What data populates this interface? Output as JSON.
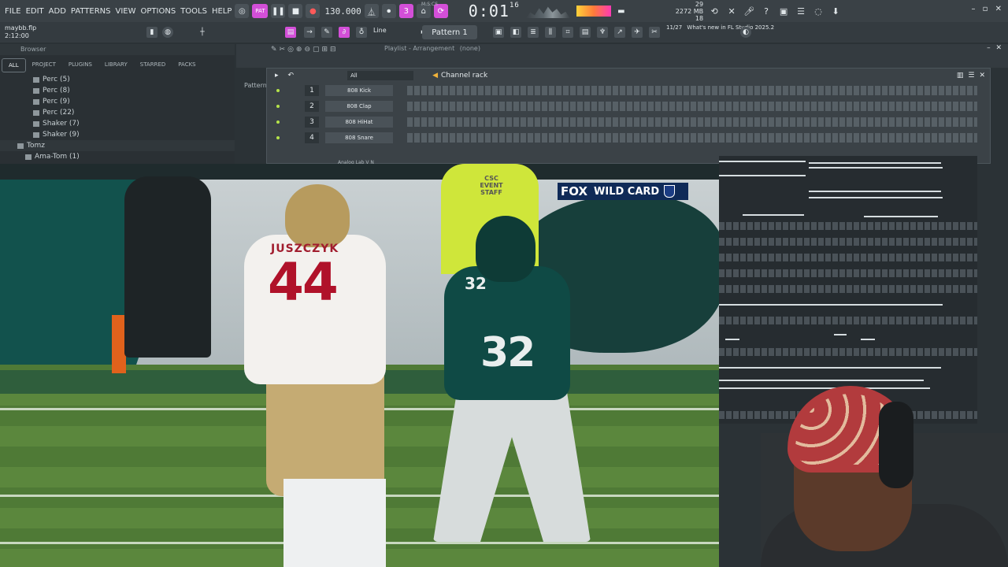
{
  "menu": [
    "FILE",
    "EDIT",
    "ADD",
    "PATTERNS",
    "VIEW",
    "OPTIONS",
    "TOOLS",
    "HELP"
  ],
  "transport": {
    "pat_label": "PAT",
    "tempo": "130.000",
    "time_main": "0:01",
    "time_sub": "16",
    "time_label": "M:S:CS"
  },
  "perf": {
    "cpu": "29",
    "mem": "2272 MB",
    "poly": "18"
  },
  "file": {
    "name": "maybb.flp",
    "length": "2:12:00"
  },
  "toolbar2": {
    "line_mode": "Line",
    "pattern": "Pattern 1",
    "news_date": "11/27",
    "news_text": "What's new in FL Studio 2025.2"
  },
  "browser": {
    "title": "Browser",
    "tabs": [
      "ALL",
      "PROJECT",
      "PLUGINS",
      "LIBRARY",
      "STARRED",
      "PACKS"
    ],
    "items": [
      {
        "label": "Perc (5)",
        "indent": 40
      },
      {
        "label": "Perc (8)",
        "indent": 40
      },
      {
        "label": "Perc (9)",
        "indent": 40
      },
      {
        "label": "Perc (22)",
        "indent": 40
      },
      {
        "label": "Shaker (7)",
        "indent": 40
      },
      {
        "label": "Shaker (9)",
        "indent": 40
      },
      {
        "label": "Tomz",
        "indent": 20
      },
      {
        "label": "Ama-Tom (1)",
        "indent": 32
      }
    ]
  },
  "playlist": {
    "title": "Playlist - Arrangement",
    "pattern_none": "(none)",
    "side_label": "Pattern"
  },
  "channel_rack": {
    "title": "Channel rack",
    "filter": "All",
    "channels": [
      {
        "num": "1",
        "name": "808 Kick"
      },
      {
        "num": "2",
        "name": "808 Clap"
      },
      {
        "num": "3",
        "name": "808 HiHat"
      },
      {
        "num": "4",
        "name": "808 Snare"
      }
    ],
    "partial_channel": "Analog Lab V N"
  },
  "broadcast": {
    "network": "FOX",
    "event": "WILD CARD",
    "staff_text": "CSC EVENT STAFF",
    "player1_name": "JUSZCZYK",
    "player1_number": "44",
    "player2_number": "32"
  },
  "colors": {
    "accent": "#d34fd8",
    "panel_bg": "#3b4247",
    "led": "#b5e34a"
  }
}
